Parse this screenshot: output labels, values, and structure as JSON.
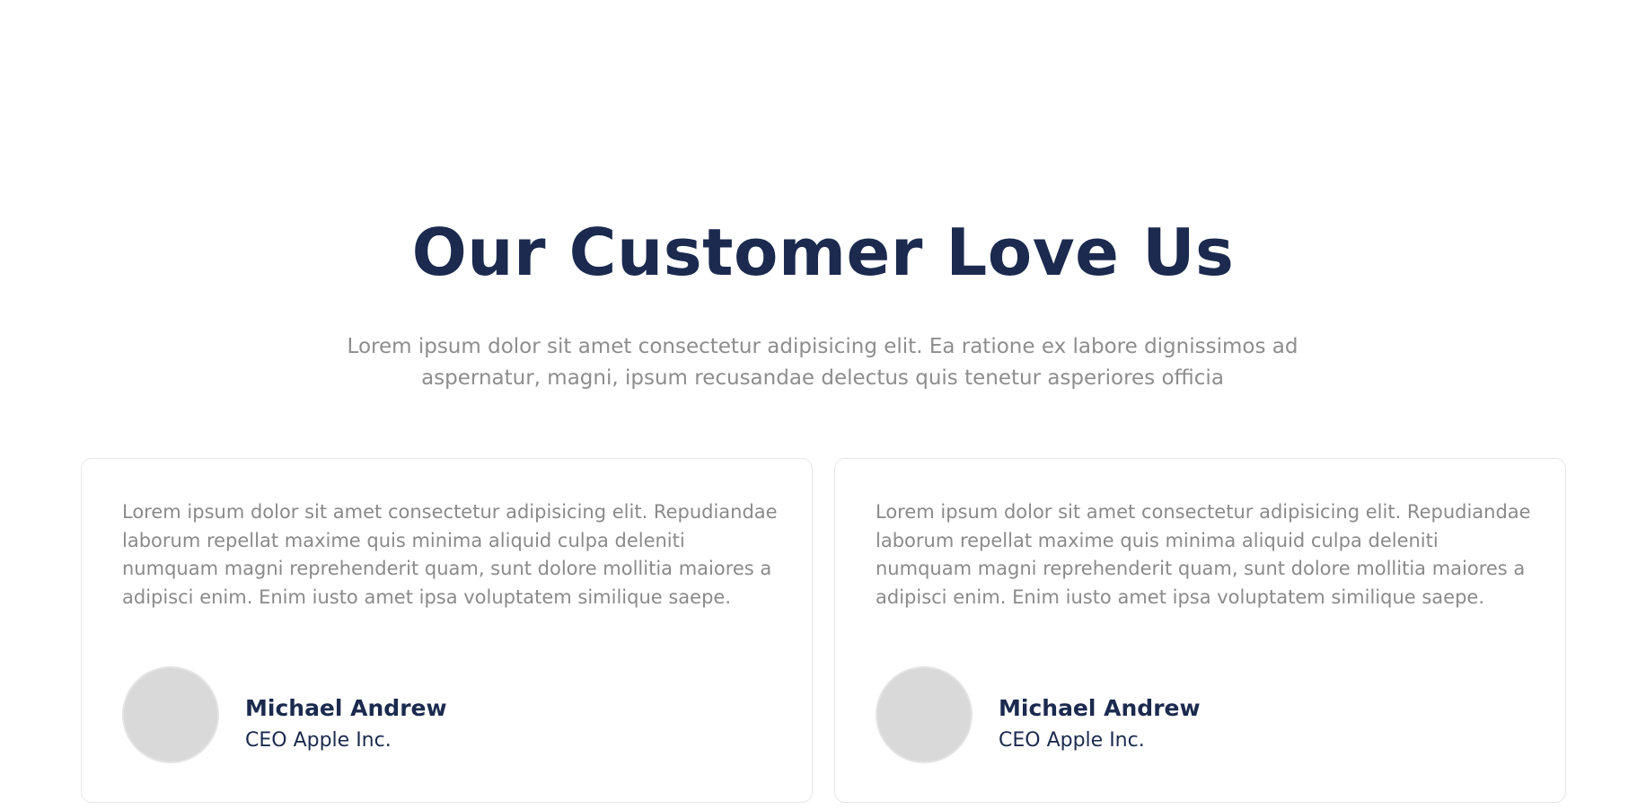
{
  "section": {
    "title": "Our Customer Love Us",
    "subtitle": "Lorem ipsum dolor sit amet consectetur adipisicing elit. Ea ratione ex labore dignissimos ad aspernatur, magni, ipsum recusandae delectus quis tenetur asperiores officia"
  },
  "testimonials": [
    {
      "quote": "Lorem ipsum dolor sit amet consectetur adipisicing elit. Repudiandae laborum repellat maxime quis minima aliquid culpa deleniti numquam magni reprehenderit quam, sunt dolore mollitia maiores a adipisci enim. Enim iusto amet ipsa voluptatem similique saepe.",
      "name": "Michael Andrew",
      "role": "CEO Apple Inc."
    },
    {
      "quote": "Lorem ipsum dolor sit amet consectetur adipisicing elit. Repudiandae laborum repellat maxime quis minima aliquid culpa deleniti numquam magni reprehenderit quam, sunt dolore mollitia maiores a adipisci enim. Enim iusto amet ipsa voluptatem similique saepe.",
      "name": "Michael Andrew",
      "role": "CEO Apple Inc."
    }
  ],
  "colors": {
    "heading": "#1b2a4e",
    "body_text": "#8d8d8d",
    "card_border": "#e6e7ea",
    "avatar_placeholder": "#d9d9d9"
  }
}
